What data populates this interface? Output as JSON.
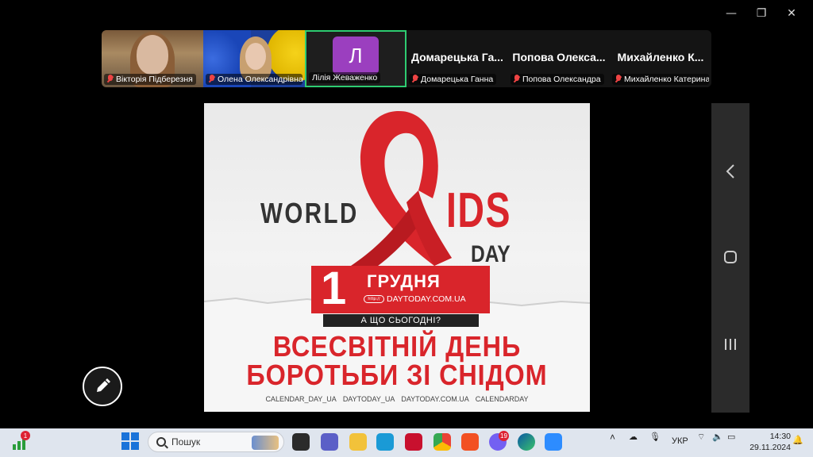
{
  "window": {
    "minimize_icon": "—",
    "restore_icon": "❐",
    "close_icon": "✕"
  },
  "participants": [
    {
      "name": "Вікторія Підберезня",
      "muted": true
    },
    {
      "name": "Олена Олександрівна",
      "muted": true
    },
    {
      "name": "Лілія Жеваженко",
      "muted": false,
      "avatar_letter": "Л",
      "avatar_color": "#9b3fbf",
      "active": true
    },
    {
      "name": "Домарецька Ганна",
      "tile_title": "Домарецька Га...",
      "muted": true
    },
    {
      "name": "Попова Олександра",
      "tile_title": "Попова Олекса...",
      "muted": true
    },
    {
      "name": "Михайленко Катерина",
      "tile_title": "Михайленко К...",
      "muted": true
    }
  ],
  "poster": {
    "world": "WORLD",
    "ids": "IDS",
    "day": "DAY",
    "date_number": "1",
    "month": "ГРУДНЯ",
    "url_pill": "http://",
    "url": "DAYTODAY.COM.UA",
    "question": "А ЩО СЬОГОДНІ?",
    "headline_line1": "ВСЕСВІТНІЙ ДЕНЬ",
    "headline_line2": "БОРОТЬБИ ЗІ СНІДОМ",
    "socials": [
      "CALENDAR_DAY_UA",
      "DAYTODAY_UA",
      "DAYTODAY.COM.UA",
      "CALENDARDAY"
    ],
    "accent_color": "#d9252b"
  },
  "android_nav": {
    "back_icon": "‹",
    "home_icon": "○",
    "recents_icon": "|||"
  },
  "taskbar": {
    "notification_badge": "1",
    "search_placeholder": "Пошук",
    "viber_badge": "19",
    "language": "УКР",
    "time": "14:30",
    "date": "29.11.2024"
  }
}
